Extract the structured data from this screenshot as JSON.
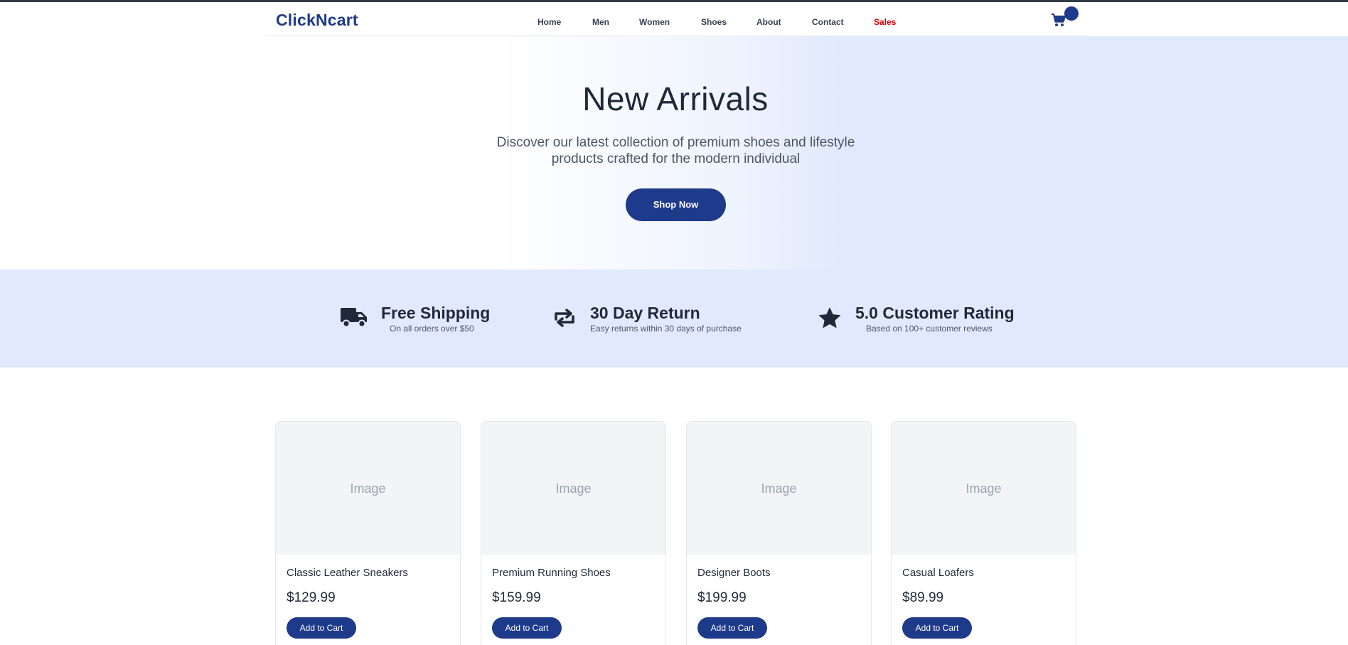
{
  "header": {
    "logo": "ClickNcart",
    "nav": [
      {
        "label": "Home"
      },
      {
        "label": "Men"
      },
      {
        "label": "Women"
      },
      {
        "label": "Shoes"
      },
      {
        "label": "About"
      },
      {
        "label": "Contact"
      },
      {
        "label": "Sales"
      }
    ],
    "cart_icon": "cart-icon"
  },
  "hero": {
    "title": "New Arrivals",
    "subtitle_line1": "Discover our latest collection of premium shoes and lifestyle",
    "subtitle_line2": "products crafted for the modern individual",
    "cta": "Shop Now"
  },
  "features": [
    {
      "icon": "truck-icon",
      "title": "Free Shipping",
      "desc": "On all orders over $50"
    },
    {
      "icon": "repeat-icon",
      "title": "30 Day Return",
      "desc": "Easy returns within 30 days of purchase"
    },
    {
      "icon": "star-icon",
      "title": "5.0 Customer Rating",
      "desc": "Based on 100+ customer reviews"
    }
  ],
  "products": [
    {
      "image_label": "Image",
      "name": "Classic Leather Sneakers",
      "price": "$129.99",
      "button": "Add to Cart"
    },
    {
      "image_label": "Image",
      "name": "Premium Running Shoes",
      "price": "$159.99",
      "button": "Add to Cart"
    },
    {
      "image_label": "Image",
      "name": "Designer Boots",
      "price": "$199.99",
      "button": "Add to Cart"
    },
    {
      "image_label": "Image",
      "name": "Casual Loafers",
      "price": "$89.99",
      "button": "Add to Cart"
    }
  ],
  "colors": {
    "brand": "#1e3a8a",
    "sales": "#dc0000",
    "feature_band": "#e1eafc"
  }
}
